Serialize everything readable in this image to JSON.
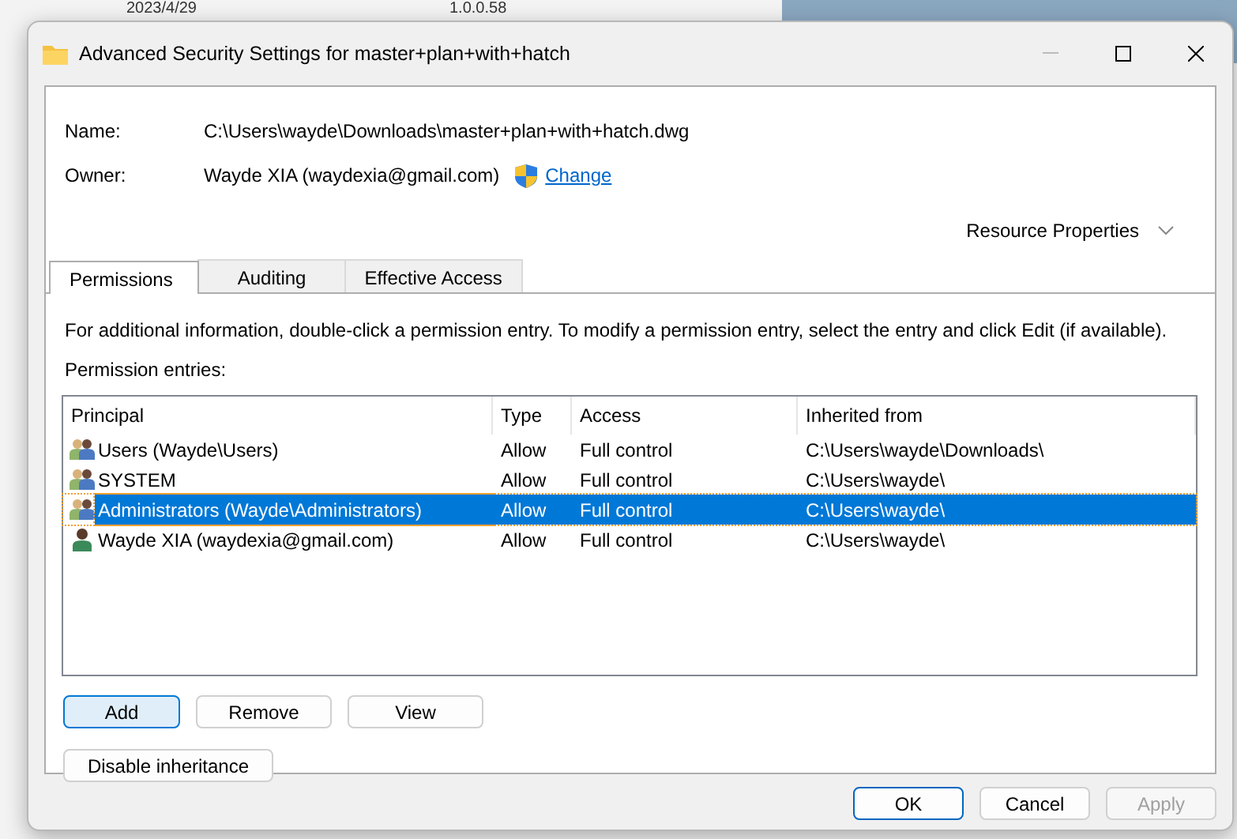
{
  "background": {
    "texts": [
      "2023/4/29",
      "1.0.0.58"
    ]
  },
  "window": {
    "title": "Advanced Security Settings for master+plan+with+hatch"
  },
  "name": {
    "label": "Name:",
    "value": "C:\\Users\\wayde\\Downloads\\master+plan+with+hatch.dwg"
  },
  "owner": {
    "label": "Owner:",
    "value": "Wayde XIA (waydexia@gmail.com)",
    "link": "Change"
  },
  "resource_properties": {
    "label": "Resource Properties",
    "expanded": false
  },
  "tabs": [
    {
      "label": "Permissions",
      "selected": true
    },
    {
      "label": "Auditing",
      "selected": false
    },
    {
      "label": "Effective Access",
      "selected": false
    }
  ],
  "instructions": "For additional information, double-click a permission entry. To modify a permission entry, select the entry and click Edit (if available).",
  "entries_label": "Permission entries:",
  "table": {
    "columns": [
      "Principal",
      "Type",
      "Access",
      "Inherited from"
    ],
    "rows": [
      {
        "kind": "group",
        "principal": "Users (Wayde\\Users)",
        "type": "Allow",
        "access": "Full control",
        "inherited_from": "C:\\Users\\wayde\\Downloads\\",
        "selected": false
      },
      {
        "kind": "group",
        "principal": "SYSTEM",
        "type": "Allow",
        "access": "Full control",
        "inherited_from": "C:\\Users\\wayde\\",
        "selected": false
      },
      {
        "kind": "group",
        "principal": "Administrators (Wayde\\Administrators)",
        "type": "Allow",
        "access": "Full control",
        "inherited_from": "C:\\Users\\wayde\\",
        "selected": true
      },
      {
        "kind": "user",
        "principal": "Wayde XIA (waydexia@gmail.com)",
        "type": "Allow",
        "access": "Full control",
        "inherited_from": "C:\\Users\\wayde\\",
        "selected": false
      }
    ]
  },
  "entry_buttons": [
    {
      "label": "Add",
      "focused": true
    },
    {
      "label": "Remove",
      "focused": false
    },
    {
      "label": "View",
      "focused": false
    }
  ],
  "inheritance_button": {
    "label": "Disable inheritance"
  },
  "dialog_buttons": [
    {
      "label": "OK",
      "default": true,
      "disabled": false
    },
    {
      "label": "Cancel",
      "default": false,
      "disabled": false
    },
    {
      "label": "Apply",
      "default": false,
      "disabled": true
    }
  ]
}
